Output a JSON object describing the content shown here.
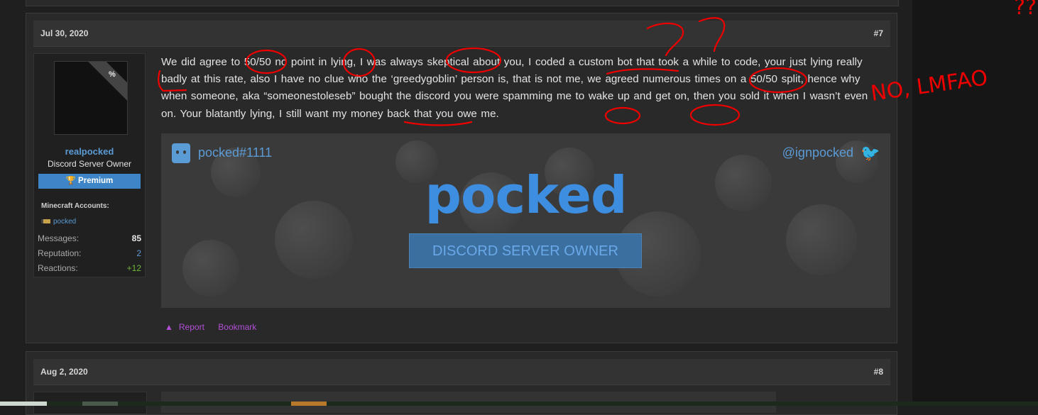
{
  "post1": {
    "date": "Jul 30, 2020",
    "number": "#7",
    "user": {
      "avatar_badge": "%",
      "name": "realpocked",
      "title": "Discord Server Owner",
      "badge_icon": "trophy-icon",
      "badge": "Premium",
      "minecraft_label": "Minecraft Accounts:",
      "minecraft_account": "pocked",
      "stats": [
        {
          "label": "Messages:",
          "value": "85"
        },
        {
          "label": "Reputation:",
          "value": "2"
        },
        {
          "label": "Reactions:",
          "value": "+12"
        }
      ]
    },
    "message": "We did agree to 50/50 no point in lying, I was always skeptical about you, I coded a custom bot that took a while to code, your just lying really badly at this rate, also I have no clue who the ‘greedygoblin’ person is, that is not me, we agreed numerous times on a 50/50 split, hence why when someone, aka “someonestoleseb” bought the discord you were spamming me to wake up and get on, then you sold it when I wasn’t even on. Your blatantly lying, I still want my money back that you owe me.",
    "banner": {
      "discord_tag": "pocked#1111",
      "twitter_handle": "@ignpocked",
      "logo": "pocked",
      "button": "DISCORD SERVER OWNER"
    },
    "actions": {
      "report": "Report",
      "bookmark": "Bookmark"
    }
  },
  "post2": {
    "date": "Aug 2, 2020",
    "number": "#8"
  },
  "annotations": {
    "question": "??",
    "reply": "NO, LMFAO"
  },
  "colors": {
    "accent": "#5b9bd6",
    "annotation": "#e00000",
    "action": "#b14fd6"
  }
}
